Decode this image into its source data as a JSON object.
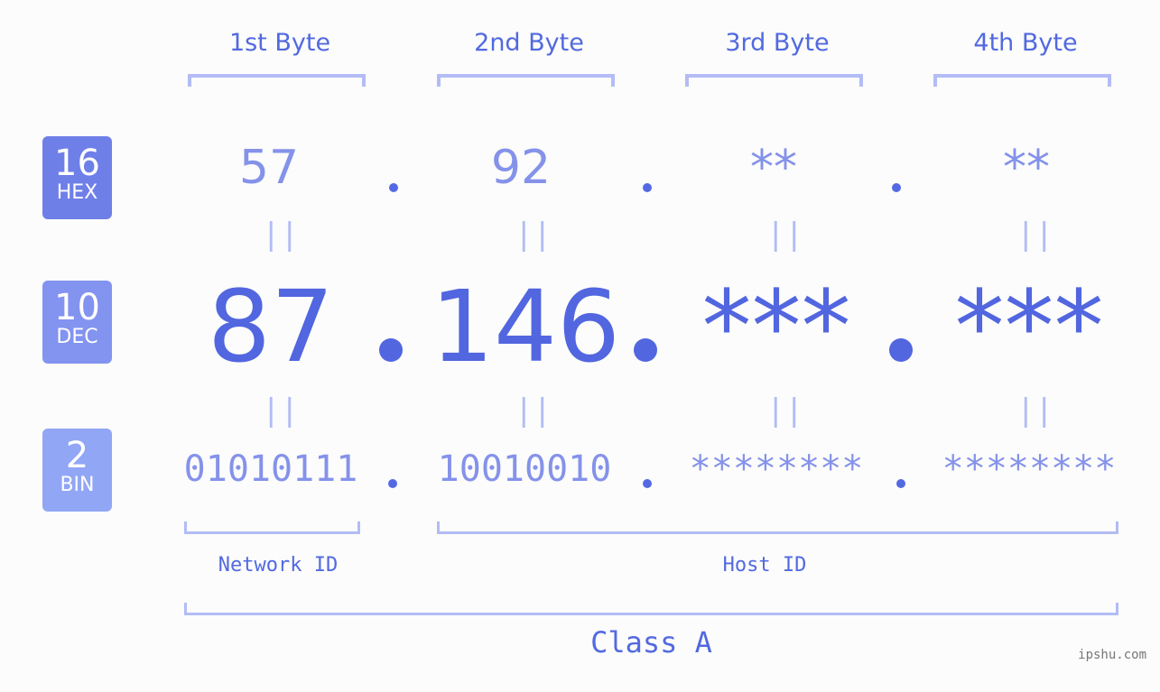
{
  "bytes": [
    {
      "label": "1st Byte",
      "hex": "57",
      "dec": "87",
      "bin": "01010111"
    },
    {
      "label": "2nd Byte",
      "hex": "92",
      "dec": "146",
      "bin": "10010010"
    },
    {
      "label": "3rd Byte",
      "hex": "**",
      "dec": "***",
      "bin": "********"
    },
    {
      "label": "4th Byte",
      "hex": "**",
      "dec": "***",
      "bin": "********"
    }
  ],
  "badges": {
    "hex": {
      "num": "16",
      "label": "HEX"
    },
    "dec": {
      "num": "10",
      "label": "DEC"
    },
    "bin": {
      "num": "2",
      "label": "BIN"
    }
  },
  "equals_symbol": "||",
  "network_id_label": "Network ID",
  "host_id_label": "Host ID",
  "class_label": "Class A",
  "watermark": "ipshu.com",
  "colors": {
    "accent": "#5266e0",
    "light": "#8592ea",
    "bracket": "#b3bcf5"
  }
}
